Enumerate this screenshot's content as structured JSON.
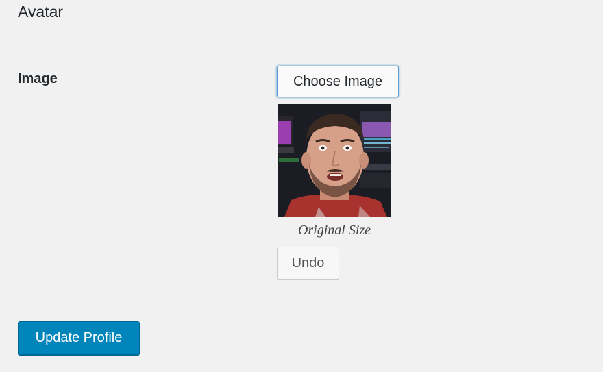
{
  "section": {
    "title": "Avatar"
  },
  "image_field": {
    "label": "Image",
    "choose_button_label": "Choose Image",
    "caption": "Original Size",
    "undo_button_label": "Undo"
  },
  "form": {
    "submit_label": "Update Profile"
  },
  "colors": {
    "primary_button": "#0085ba",
    "page_background": "#f1f1f1",
    "focus_border": "#5b9dd9"
  }
}
